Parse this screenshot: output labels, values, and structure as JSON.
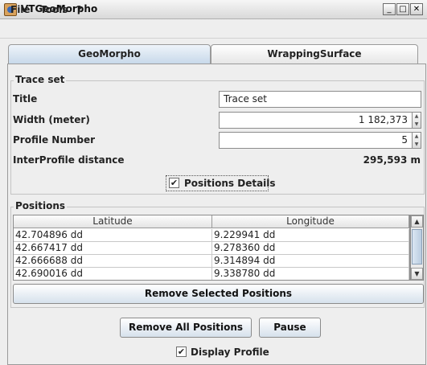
{
  "window": {
    "title": "VTGeoMorpho",
    "min_label": "_",
    "max_label": "□",
    "close_label": "✕"
  },
  "menu": {
    "items": [
      "File",
      "Tools",
      "?"
    ]
  },
  "tabs": [
    "GeoMorpho",
    "WrappingSurface"
  ],
  "trace_set": {
    "group_title": "Trace set",
    "title_label": "Title",
    "title_value": "Trace set",
    "width_label": "Width (meter)",
    "width_value": "1 182,373",
    "profile_label": "Profile Number",
    "profile_value": "5",
    "interprofile_label": "InterProfile distance",
    "interprofile_value": "295,593 m"
  },
  "positions_details": {
    "label": "Positions Details",
    "checked": true
  },
  "positions": {
    "group_title": "Positions",
    "columns": [
      "Latitude",
      "Longitude"
    ],
    "rows": [
      [
        "42.704896 dd",
        "9.229941 dd"
      ],
      [
        "42.667417 dd",
        "9.278360 dd"
      ],
      [
        "42.666688 dd",
        "9.314894 dd"
      ],
      [
        "42.690016 dd",
        "9.338780 dd"
      ]
    ],
    "remove_selected_label": "Remove Selected Positions"
  },
  "actions": {
    "remove_all_label": "Remove All Positions",
    "pause_label": "Pause"
  },
  "display_profile": {
    "label": "Display Profile",
    "checked": true
  },
  "check_mark": "✔"
}
